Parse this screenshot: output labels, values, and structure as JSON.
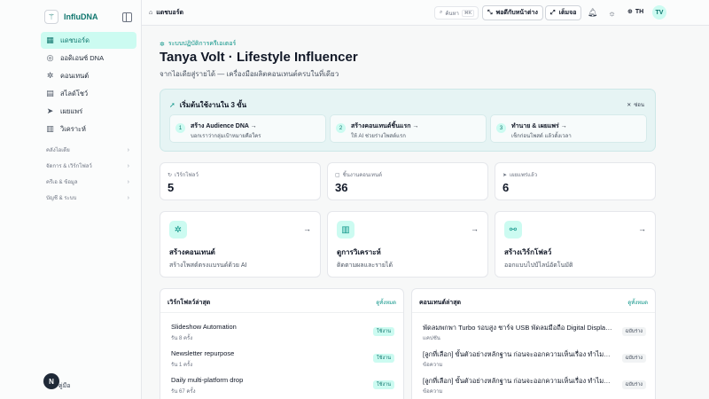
{
  "app": {
    "name": "InfluDNA",
    "logo_glyph": "⚚"
  },
  "sidebar": {
    "items": [
      {
        "label": "แดชบอร์ด",
        "icon": "grid-icon",
        "glyph": "▦",
        "active": true
      },
      {
        "label": "ออดิเอนซ์ DNA",
        "icon": "fingerprint-icon",
        "glyph": "◎",
        "active": false
      },
      {
        "label": "คอนเทนต์",
        "icon": "sparkle-icon",
        "glyph": "✲",
        "active": false
      },
      {
        "label": "สไลด์โชว์",
        "icon": "layout-icon",
        "glyph": "▤",
        "active": false
      },
      {
        "label": "เผยแพร่",
        "icon": "send-icon",
        "glyph": "➤",
        "active": false
      },
      {
        "label": "วิเคราะห์",
        "icon": "chart-icon",
        "glyph": "▥",
        "active": false
      }
    ],
    "groups": [
      {
        "label": "คลังไอเดีย"
      },
      {
        "label": "จัดการ & เวิร์กโฟลว์"
      },
      {
        "label": "ครีเอ & ข้อมูล"
      },
      {
        "label": "บัญชี & ระบบ"
      }
    ],
    "user_initial": "N",
    "user_label": "คู่มือ"
  },
  "topbar": {
    "breadcrumb": "แดชบอร์ด",
    "search_placeholder": "ค้นหา",
    "search_kbd": "⌘K",
    "collapse_button": "พอดีกับหน้าต่าง",
    "fullscreen_button": "เต็มจอ",
    "language": "TH",
    "avatar_initials": "TV"
  },
  "hero": {
    "eyebrow": "ระบบปฏิบัติการครีเอเตอร์",
    "title": "Tanya Volt · Lifestyle Influencer",
    "subtitle": "จากไอเดียสู่รายได้ — เครื่องมือผลิตคอนเทนต์ครบในที่เดียว"
  },
  "onboarding": {
    "title": "เริ่มต้นใช้งานใน 3 ขั้น",
    "hide_label": "ซ่อน",
    "steps": [
      {
        "num": "1",
        "title": "สร้าง Audience DNA →",
        "sub": "บอกเราว่ากลุ่มเป้าหมายคือใคร"
      },
      {
        "num": "2",
        "title": "สร้างคอนเทนต์ชิ้นแรก →",
        "sub": "ให้ AI ช่วยร่างโพสต์แรก"
      },
      {
        "num": "3",
        "title": "ทำนาย & เผยแพร่ →",
        "sub": "เช็กก่อนโพสต์ แล้วตั้งเวลา"
      }
    ]
  },
  "stats": [
    {
      "label": "เวิร์กโฟลว์",
      "value": "5",
      "icon": "workflow-icon",
      "glyph": "↻"
    },
    {
      "label": "ชิ้นงานคอนเทนต์",
      "value": "36",
      "icon": "file-icon",
      "glyph": "▢"
    },
    {
      "label": "เผยแพร่แล้ว",
      "value": "6",
      "icon": "send-icon",
      "glyph": "➤"
    }
  ],
  "actions": [
    {
      "title": "สร้างคอนเทนต์",
      "sub": "สร้างโพสต์ตรงแบรนด์ด้วย AI",
      "icon": "sparkle-icon",
      "glyph": "✲"
    },
    {
      "title": "ดูการวิเคราะห์",
      "sub": "ติดตามผลและรายได้",
      "icon": "chart-icon",
      "glyph": "▥"
    },
    {
      "title": "สร้างเวิร์กโฟลว์",
      "sub": "ออกแบบไปป์ไลน์อัตโนมัติ",
      "icon": "workflow-icon",
      "glyph": "⚯"
    }
  ],
  "workflows_panel": {
    "title": "เวิร์กโฟลว์ล่าสุด",
    "link": "ดูทั้งหมด",
    "rows": [
      {
        "title": "Slideshow Automation",
        "sub": "รัน 8 ครั้ง",
        "badge": "ใช้งาน"
      },
      {
        "title": "Newsletter repurpose",
        "sub": "รัน 1 ครั้ง",
        "badge": "ใช้งาน"
      },
      {
        "title": "Daily multi-platform drop",
        "sub": "รัน 67 ครั้ง",
        "badge": "ใช้งาน"
      }
    ]
  },
  "content_panel": {
    "title": "คอนเทนต์ล่าสุด",
    "link": "ดูทั้งหมด",
    "rows": [
      {
        "title": "พัดลมพกพา Turbo รอบสูง ชาร์จ USB พัดลมมือถือ Digital Display มือถือ...",
        "sub": "แคปชัน",
        "badge": "ฉบับร่าง"
      },
      {
        "title": "[ลูกที่เลือก] ขั้นตัวอย่างหลักฐาน ก่อนจะออกความเห็นเรื่อง ทำไมแซรั่มถูกกว่าถึง...",
        "sub": "ข้อความ",
        "badge": "ฉบับร่าง"
      },
      {
        "title": "[ลูกที่เลือก] ขั้นตัวอย่างหลักฐาน ก่อนจะออกความเห็นเรื่อง ทำไมแซรั่มถูกกว่าถึง...",
        "sub": "ข้อความ",
        "badge": "ฉบับร่าง"
      }
    ]
  },
  "colors": {
    "accent": "#0d9488",
    "accent_soft": "#ccfbf1",
    "onboard_bg": "#e6f4f4"
  }
}
